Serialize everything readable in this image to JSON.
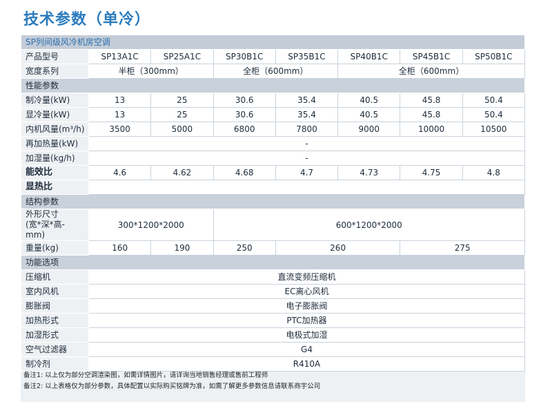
{
  "page": {
    "title": "技术参数（单冷）"
  },
  "table": {
    "heading": "SP列间级风冷机房空调",
    "model": {
      "label": "产品型号",
      "values": [
        "SP13A1C",
        "SP25A1C",
        "SP30B1C",
        "SP35B1C",
        "SP40B1C",
        "SP45B1C",
        "SP50B1C"
      ]
    },
    "width_series": {
      "label": "宽度系列",
      "half": "半柜（300mm）",
      "full_a": "全柜（600mm）",
      "full_b": "全柜（600mm）"
    },
    "section_performance": "性能参数",
    "cooling": {
      "label": "制冷量(kW)",
      "values": [
        "13",
        "25",
        "30.6",
        "35.4",
        "40.5",
        "45.8",
        "50.4"
      ]
    },
    "sensible": {
      "label": "显冷量(kW)",
      "values": [
        "13",
        "25",
        "30.6",
        "35.4",
        "40.5",
        "45.8",
        "50.4"
      ]
    },
    "airflow": {
      "label": "内机风量(m³/h)",
      "values": [
        "3500",
        "5000",
        "6800",
        "7800",
        "9000",
        "10000",
        "10500"
      ]
    },
    "reheat": {
      "label": "再加热量(kW)",
      "value": "-"
    },
    "humidify": {
      "label": "加湿量(kg/h)",
      "value": "-"
    },
    "eer": {
      "label": "能效比",
      "values": [
        "4.6",
        "4.62",
        "4.68",
        "4.7",
        "4.73",
        "4.75",
        "4.8"
      ]
    },
    "shr": {
      "label": "显热比",
      "value": ""
    },
    "section_structure": "结构参数",
    "dimensions": {
      "label": "外形尺寸\n(宽*深*高-mm)",
      "a": "300*1200*2000",
      "b": "600*1200*2000"
    },
    "weight": {
      "label": "重量(kg)",
      "values": [
        "160",
        "190",
        "250",
        "260",
        "275"
      ]
    },
    "section_options": "功能选项",
    "compressor": {
      "label": "压缩机",
      "value": "直流变频压缩机"
    },
    "indoor_fan": {
      "label": "室内风机",
      "value": "EC离心风机"
    },
    "expansion_valve": {
      "label": "膨胀阀",
      "value": "电子膨胀阀"
    },
    "heating": {
      "label": "加热形式",
      "value": "PTC加热器"
    },
    "humidifier": {
      "label": "加湿形式",
      "value": "电极式加湿"
    },
    "air_filter": {
      "label": "空气过滤器",
      "value": "G4"
    },
    "refrigerant": {
      "label": "制冷剂",
      "value": "R410A"
    }
  },
  "notes": [
    "备注1: 以上仅为部分空调渲染图，如需详情图片，请详询当地销售经理或售前工程师",
    "备注2: 以上表格仅为部分参数，具体配置以实际购买铭牌为准，如需了解更多参数信息请联系商宇公司"
  ],
  "colors": {
    "title": "#2b7bbd",
    "band": "#c9d1da",
    "label_bg": "#eef1f4"
  }
}
